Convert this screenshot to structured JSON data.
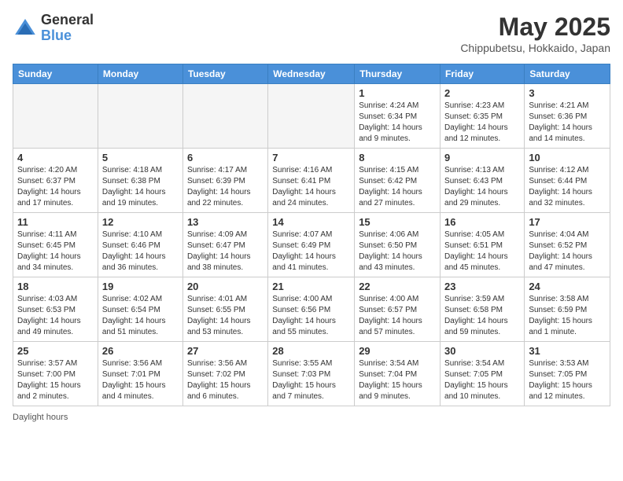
{
  "logo": {
    "general": "General",
    "blue": "Blue"
  },
  "title": "May 2025",
  "location": "Chippubetsu, Hokkaido, Japan",
  "days_of_week": [
    "Sunday",
    "Monday",
    "Tuesday",
    "Wednesday",
    "Thursday",
    "Friday",
    "Saturday"
  ],
  "weeks": [
    [
      {
        "day": "",
        "info": ""
      },
      {
        "day": "",
        "info": ""
      },
      {
        "day": "",
        "info": ""
      },
      {
        "day": "",
        "info": ""
      },
      {
        "day": "1",
        "info": "Sunrise: 4:24 AM\nSunset: 6:34 PM\nDaylight: 14 hours and 9 minutes."
      },
      {
        "day": "2",
        "info": "Sunrise: 4:23 AM\nSunset: 6:35 PM\nDaylight: 14 hours and 12 minutes."
      },
      {
        "day": "3",
        "info": "Sunrise: 4:21 AM\nSunset: 6:36 PM\nDaylight: 14 hours and 14 minutes."
      }
    ],
    [
      {
        "day": "4",
        "info": "Sunrise: 4:20 AM\nSunset: 6:37 PM\nDaylight: 14 hours and 17 minutes."
      },
      {
        "day": "5",
        "info": "Sunrise: 4:18 AM\nSunset: 6:38 PM\nDaylight: 14 hours and 19 minutes."
      },
      {
        "day": "6",
        "info": "Sunrise: 4:17 AM\nSunset: 6:39 PM\nDaylight: 14 hours and 22 minutes."
      },
      {
        "day": "7",
        "info": "Sunrise: 4:16 AM\nSunset: 6:41 PM\nDaylight: 14 hours and 24 minutes."
      },
      {
        "day": "8",
        "info": "Sunrise: 4:15 AM\nSunset: 6:42 PM\nDaylight: 14 hours and 27 minutes."
      },
      {
        "day": "9",
        "info": "Sunrise: 4:13 AM\nSunset: 6:43 PM\nDaylight: 14 hours and 29 minutes."
      },
      {
        "day": "10",
        "info": "Sunrise: 4:12 AM\nSunset: 6:44 PM\nDaylight: 14 hours and 32 minutes."
      }
    ],
    [
      {
        "day": "11",
        "info": "Sunrise: 4:11 AM\nSunset: 6:45 PM\nDaylight: 14 hours and 34 minutes."
      },
      {
        "day": "12",
        "info": "Sunrise: 4:10 AM\nSunset: 6:46 PM\nDaylight: 14 hours and 36 minutes."
      },
      {
        "day": "13",
        "info": "Sunrise: 4:09 AM\nSunset: 6:47 PM\nDaylight: 14 hours and 38 minutes."
      },
      {
        "day": "14",
        "info": "Sunrise: 4:07 AM\nSunset: 6:49 PM\nDaylight: 14 hours and 41 minutes."
      },
      {
        "day": "15",
        "info": "Sunrise: 4:06 AM\nSunset: 6:50 PM\nDaylight: 14 hours and 43 minutes."
      },
      {
        "day": "16",
        "info": "Sunrise: 4:05 AM\nSunset: 6:51 PM\nDaylight: 14 hours and 45 minutes."
      },
      {
        "day": "17",
        "info": "Sunrise: 4:04 AM\nSunset: 6:52 PM\nDaylight: 14 hours and 47 minutes."
      }
    ],
    [
      {
        "day": "18",
        "info": "Sunrise: 4:03 AM\nSunset: 6:53 PM\nDaylight: 14 hours and 49 minutes."
      },
      {
        "day": "19",
        "info": "Sunrise: 4:02 AM\nSunset: 6:54 PM\nDaylight: 14 hours and 51 minutes."
      },
      {
        "day": "20",
        "info": "Sunrise: 4:01 AM\nSunset: 6:55 PM\nDaylight: 14 hours and 53 minutes."
      },
      {
        "day": "21",
        "info": "Sunrise: 4:00 AM\nSunset: 6:56 PM\nDaylight: 14 hours and 55 minutes."
      },
      {
        "day": "22",
        "info": "Sunrise: 4:00 AM\nSunset: 6:57 PM\nDaylight: 14 hours and 57 minutes."
      },
      {
        "day": "23",
        "info": "Sunrise: 3:59 AM\nSunset: 6:58 PM\nDaylight: 14 hours and 59 minutes."
      },
      {
        "day": "24",
        "info": "Sunrise: 3:58 AM\nSunset: 6:59 PM\nDaylight: 15 hours and 1 minute."
      }
    ],
    [
      {
        "day": "25",
        "info": "Sunrise: 3:57 AM\nSunset: 7:00 PM\nDaylight: 15 hours and 2 minutes."
      },
      {
        "day": "26",
        "info": "Sunrise: 3:56 AM\nSunset: 7:01 PM\nDaylight: 15 hours and 4 minutes."
      },
      {
        "day": "27",
        "info": "Sunrise: 3:56 AM\nSunset: 7:02 PM\nDaylight: 15 hours and 6 minutes."
      },
      {
        "day": "28",
        "info": "Sunrise: 3:55 AM\nSunset: 7:03 PM\nDaylight: 15 hours and 7 minutes."
      },
      {
        "day": "29",
        "info": "Sunrise: 3:54 AM\nSunset: 7:04 PM\nDaylight: 15 hours and 9 minutes."
      },
      {
        "day": "30",
        "info": "Sunrise: 3:54 AM\nSunset: 7:05 PM\nDaylight: 15 hours and 10 minutes."
      },
      {
        "day": "31",
        "info": "Sunrise: 3:53 AM\nSunset: 7:05 PM\nDaylight: 15 hours and 12 minutes."
      }
    ]
  ],
  "footer": "Daylight hours"
}
